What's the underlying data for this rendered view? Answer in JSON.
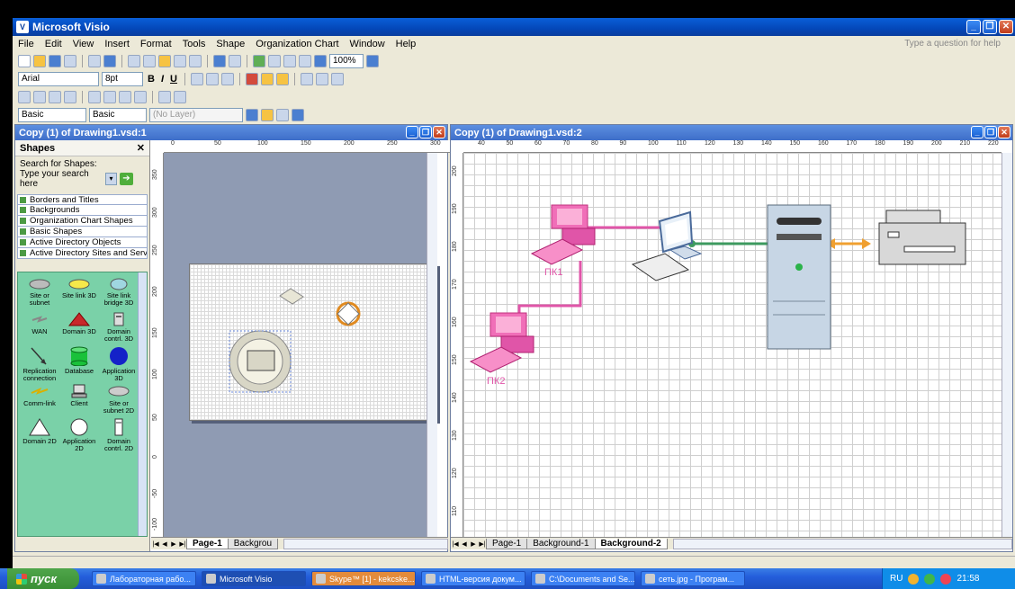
{
  "app": {
    "title": "Microsoft Visio",
    "help_placeholder": "Type a question for help"
  },
  "menu": [
    "File",
    "Edit",
    "View",
    "Insert",
    "Format",
    "Tools",
    "Shape",
    "Organization Chart",
    "Window",
    "Help"
  ],
  "toolbar": {
    "zoom": "100%",
    "font": "Arial",
    "size": "8pt",
    "bold": "B",
    "italic": "I",
    "underline": "U",
    "line_style": "Basic",
    "fill_style": "Basic",
    "layer": "(No Layer)"
  },
  "left_window": {
    "title": "Copy (1) of Drawing1.vsd:1",
    "tabs": [
      "Page-1",
      "Backgrou"
    ],
    "ruler_h": [
      "0",
      "50",
      "100",
      "150",
      "200",
      "250",
      "300"
    ],
    "ruler_v": [
      "350",
      "300",
      "250",
      "200",
      "150",
      "100",
      "50",
      "0",
      "-50",
      "-100"
    ]
  },
  "shapes_panel": {
    "title": "Shapes",
    "search_label": "Search for Shapes:",
    "search_placeholder": "Type your search here",
    "stencils": [
      "Borders and Titles",
      "Backgrounds",
      "Organization Chart Shapes",
      "Basic Shapes",
      "Active Directory Objects",
      "Active Directory Sites and Servi..."
    ],
    "items": [
      {
        "label": "Site or subnet",
        "icon": "site-oval"
      },
      {
        "label": "Site link 3D",
        "icon": "yellow-oval"
      },
      {
        "label": "Site link bridge 3D",
        "icon": "bridge"
      },
      {
        "label": "WAN",
        "icon": "wan-bolt"
      },
      {
        "label": "Domain 3D",
        "icon": "red-triangle"
      },
      {
        "label": "Domain contrl. 3D",
        "icon": "server-3d"
      },
      {
        "label": "Replication connection",
        "icon": "arrow"
      },
      {
        "label": "Database",
        "icon": "green-cylinder"
      },
      {
        "label": "Application 3D",
        "icon": "blue-circle"
      },
      {
        "label": "Comm-link",
        "icon": "bolt"
      },
      {
        "label": "Client",
        "icon": "client-pc"
      },
      {
        "label": "Site or subnet 2D",
        "icon": "gray-oval"
      },
      {
        "label": "Domain 2D",
        "icon": "white-triangle"
      },
      {
        "label": "Application 2D",
        "icon": "white-circle"
      },
      {
        "label": "Domain contrl. 2D",
        "icon": "server-2d"
      }
    ]
  },
  "right_window": {
    "title": "Copy (1) of Drawing1.vsd:2",
    "tabs": [
      "Page-1",
      "Background-1",
      "Background-2"
    ],
    "ruler_h": [
      "40",
      "50",
      "60",
      "70",
      "80",
      "90",
      "100",
      "110",
      "120",
      "130",
      "140",
      "150",
      "160",
      "170",
      "180",
      "190",
      "200",
      "210",
      "220"
    ],
    "ruler_v": [
      "200",
      "190",
      "180",
      "170",
      "160",
      "150",
      "140",
      "130",
      "120",
      "110"
    ],
    "labels": {
      "pc1": "ПК1",
      "pc2": "ПК2"
    },
    "colors": {
      "pink": "#e055a8",
      "green_link": "#3d9a5f",
      "orange_arrow": "#f0a030"
    }
  },
  "taskbar": {
    "start": "пуск",
    "tasks": [
      "Лабораторная рабо...",
      "Microsoft Visio",
      "Skype™ [1] - kekcske...",
      "HTML-версия докум...",
      "C:\\Documents and Se...",
      "сеть.jpg - Програм..."
    ],
    "lang": "RU",
    "clock": "21:58"
  }
}
